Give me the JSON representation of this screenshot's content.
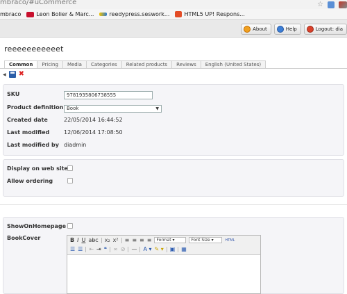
{
  "browser": {
    "url": "mbraco/#uCommerce",
    "bookmarks": [
      {
        "label": "mbraco"
      },
      {
        "label": "Leon Bolier & Marc..."
      },
      {
        "label": "reedypress.seswork..."
      },
      {
        "label": "HTML5 UP! Respons..."
      }
    ]
  },
  "toolbar": {
    "about_label": "About",
    "help_label": "Help",
    "logout_label": "Logout: dia"
  },
  "page": {
    "title": "reeeeeeeeeeet",
    "tabs": [
      "Common",
      "Pricing",
      "Media",
      "Categories",
      "Related products",
      "Reviews",
      "English (United States)"
    ],
    "active_tab": "Common"
  },
  "fields": {
    "sku_label": "SKU",
    "sku_value": "9781935806738555",
    "definition_label": "Product definition",
    "definition_value": "Book",
    "created_label": "Created date",
    "created_value": "22/05/2014 16:44:52",
    "modified_label": "Last modified",
    "modified_value": "12/06/2014 17:08:50",
    "modified_by_label": "Last modified by",
    "modified_by_value": "diadmin",
    "display_web_label": "Display on web site",
    "allow_ordering_label": "Allow ordering",
    "show_homepage_label": "ShowOnHomepage",
    "bookcover_label": "BookCover"
  },
  "editor": {
    "format_label": "Format",
    "fontsize_label": "Font Size",
    "html_label": "HTML"
  }
}
